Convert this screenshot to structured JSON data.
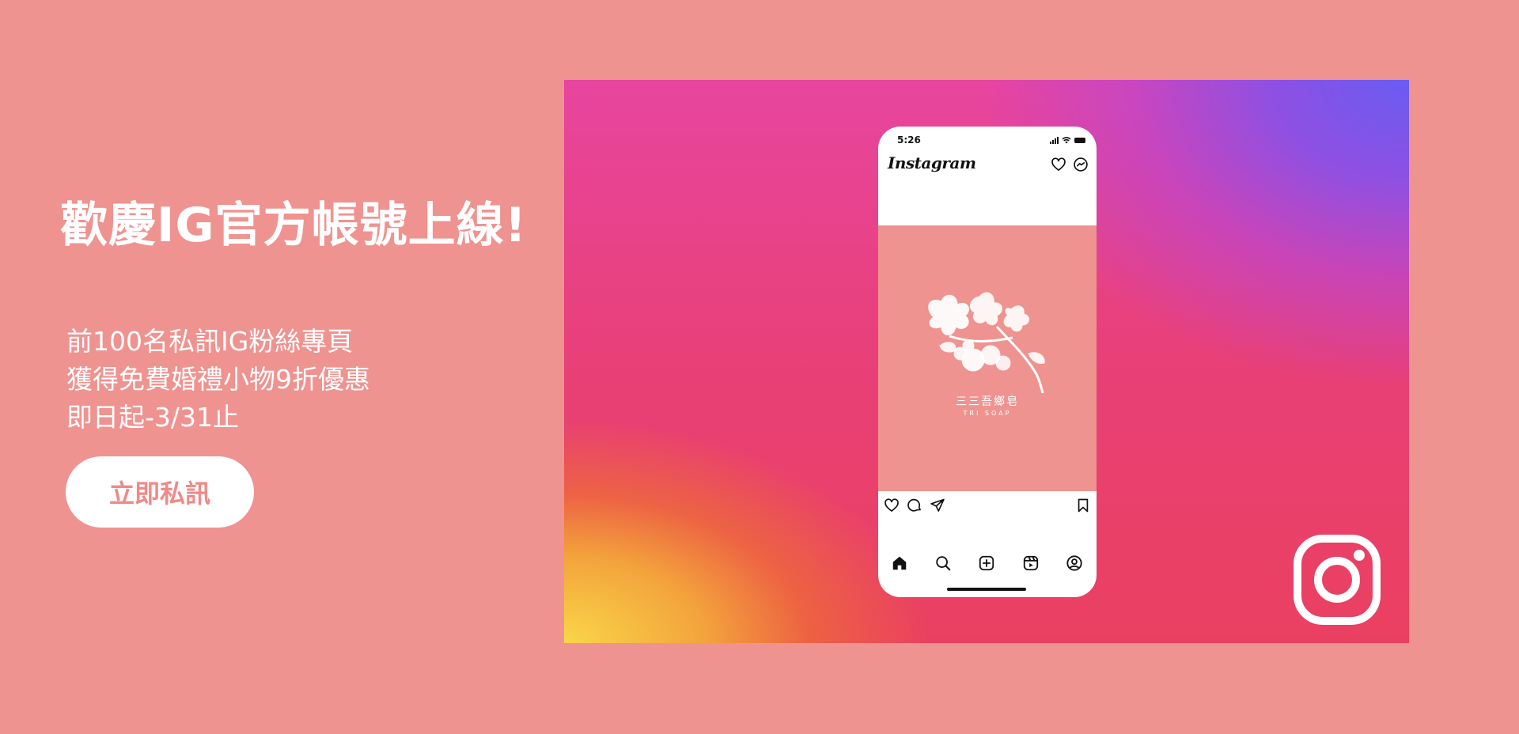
{
  "headline": "歡慶IG官方帳號上線!",
  "promo": {
    "lines": [
      "前100名私訊IG粉絲專頁",
      "獲得免費婚禮小物9折優惠",
      "即日起-3/31止"
    ]
  },
  "cta": {
    "label": "立即私訊"
  },
  "phone": {
    "status_time": "5:26",
    "app_name": "Instagram",
    "post": {
      "brand_name_cn": "三三吾鄉皂",
      "brand_name_en": "TRI SOAP"
    },
    "header_icons": [
      "heart-icon",
      "messenger-icon"
    ],
    "action_icons": [
      "like-icon",
      "comment-icon",
      "share-icon",
      "bookmark-icon"
    ],
    "nav_icons": [
      "home-icon",
      "search-icon",
      "create-icon",
      "reels-icon",
      "profile-icon"
    ]
  },
  "colors": {
    "background": "#ef9390",
    "cta_text": "#ef8a88",
    "gradient_yellow": "#f9d648",
    "gradient_pink": "#e8459f",
    "gradient_purple": "#6a5cf2"
  },
  "icons": {
    "instagram_logo": "instagram-logo-icon"
  }
}
